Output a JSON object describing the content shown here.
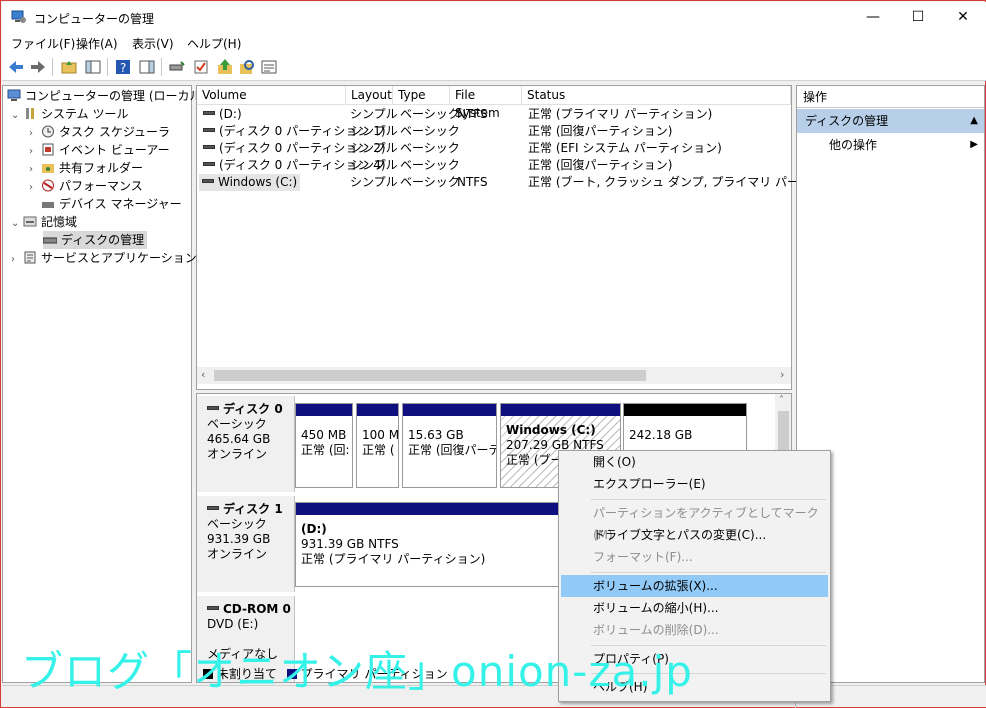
{
  "window": {
    "title": "コンピューターの管理",
    "min": "—",
    "max": "☐",
    "close": "✕"
  },
  "menu": [
    "ファイル(F)",
    "操作(A)",
    "表示(V)",
    "ヘルプ(H)"
  ],
  "tree": {
    "root": "コンピューターの管理 (ローカル)",
    "system_tools": "システム ツール",
    "task_scheduler": "タスク スケジューラ",
    "event_viewer": "イベント ビューアー",
    "shared_folders": "共有フォルダー",
    "performance": "パフォーマンス",
    "device_manager": "デバイス マネージャー",
    "storage": "記憶域",
    "disk_management": "ディスクの管理",
    "services_apps": "サービスとアプリケーション"
  },
  "volumes": {
    "headers": [
      "Volume",
      "Layout",
      "Type",
      "File System",
      "Status"
    ],
    "rows": [
      [
        "(D:)",
        "シンプル",
        "ベーシック",
        "NTFS",
        "正常 (プライマリ パーティション)"
      ],
      [
        "(ディスク 0 パーティション 1)",
        "シンプル",
        "ベーシック",
        "",
        "正常 (回復パーティション)"
      ],
      [
        "(ディスク 0 パーティション 2)",
        "シンプル",
        "ベーシック",
        "",
        "正常 (EFI システム パーティション)"
      ],
      [
        "(ディスク 0 パーティション 4)",
        "シンプル",
        "ベーシック",
        "",
        "正常 (回復パーティション)"
      ],
      [
        "Windows (C:)",
        "シンプル",
        "ベーシック",
        "NTFS",
        "正常 (ブート, クラッシュ ダンプ, プライマリ パーティション)"
      ]
    ]
  },
  "disks": {
    "disk0": {
      "name": "ディスク 0",
      "type": "ベーシック",
      "size": "465.64 GB",
      "status": "オンライン",
      "parts": [
        {
          "size": "450 MB",
          "status": "正常 (回:"
        },
        {
          "size": "100 M",
          "status": "正常 ("
        },
        {
          "size": "15.63 GB",
          "status": "正常 (回復パーテ"
        },
        {
          "name": "Windows (C:)",
          "size": "207.29 GB NTFS",
          "status": "正常 (ブー"
        },
        {
          "size": "242.18 GB",
          "status": ""
        }
      ]
    },
    "disk1": {
      "name": "ディスク 1",
      "type": "ベーシック",
      "size": "931.39 GB",
      "status": "オンライン",
      "parts": [
        {
          "name": "(D:)",
          "size": "931.39 GB NTFS",
          "status": "正常 (プライマリ パーティション)"
        }
      ]
    },
    "cdrom": {
      "name": "CD-ROM 0",
      "type": "DVD (E:)",
      "media": "メディアなし"
    }
  },
  "legend": {
    "unallocated": "未割り当て",
    "primary": "プライマリ パーティション"
  },
  "actions": {
    "header": "操作",
    "section": "ディスクの管理",
    "more": "他の操作"
  },
  "context_menu": {
    "open": "開く(O)",
    "explorer": "エクスプローラー(E)",
    "mark_active": "パーティションをアクティブとしてマーク(M)",
    "change_letter": "ドライブ文字とパスの変更(C)...",
    "format": "フォーマット(F)...",
    "extend": "ボリュームの拡張(X)...",
    "shrink": "ボリュームの縮小(H)...",
    "delete": "ボリュームの削除(D)...",
    "properties": "プロパティ(P)",
    "help": "ヘルプ(H)"
  },
  "watermark": "ブログ「オニオン座」onion-za.jp"
}
